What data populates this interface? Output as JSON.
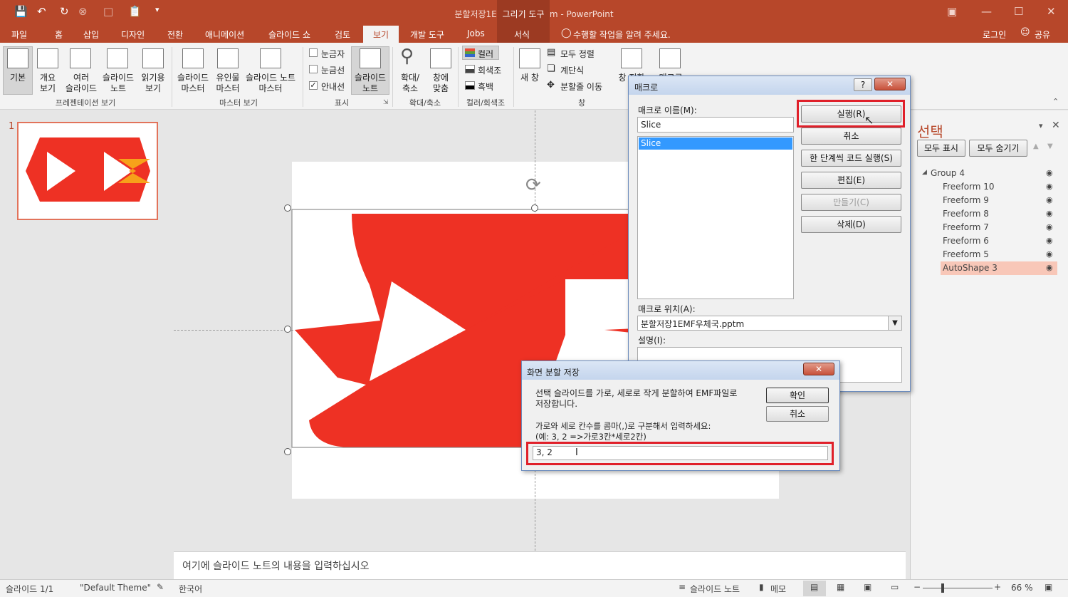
{
  "titlebar": {
    "title": "분할저장1EMF우체국.pptm - PowerPoint",
    "context_tab_header": "그리기 도구"
  },
  "tabs": [
    "파일",
    "홈",
    "삽입",
    "디자인",
    "전환",
    "애니메이션",
    "슬라이드 쇼",
    "검토",
    "보기",
    "개발 도구",
    "Jobs",
    "서식"
  ],
  "tell_me": "수행할 작업을 알려 주세요.",
  "login": "로그인",
  "share": "공유",
  "ribbon": {
    "presentation_views": {
      "items": [
        "기본",
        "개요\n보기",
        "여러\n슬라이드",
        "슬라이드\n노트",
        "읽기용\n보기"
      ],
      "group": "프레젠테이션 보기"
    },
    "master_views": {
      "items": [
        "슬라이드\n마스터",
        "유인물\n마스터",
        "슬라이드 노트\n마스터"
      ],
      "group": "마스터 보기"
    },
    "show": {
      "checks": [
        {
          "label": "눈금자",
          "checked": false
        },
        {
          "label": "눈금선",
          "checked": false
        },
        {
          "label": "안내선",
          "checked": true
        }
      ],
      "notes": "슬라이드\n노트",
      "group": "표시"
    },
    "zoom": {
      "items": [
        "확대/\n축소",
        "창에\n맞춤"
      ],
      "group": "확대/축소"
    },
    "color": {
      "items": [
        "컬러",
        "회색조",
        "흑백"
      ],
      "group": "컬러/회색조"
    },
    "window": {
      "new_window": "새 창",
      "items": [
        "모두 정렬",
        "계단식",
        "분할줄 이동"
      ],
      "switch": "창 전환",
      "group": "창"
    },
    "macro": {
      "label": "매크로"
    }
  },
  "thumbnail": {
    "number": "1"
  },
  "notes_placeholder": "여기에 슬라이드 노트의 내용을 입력하십시오",
  "selection_pane": {
    "title": "선택",
    "show_all": "모두 표시",
    "hide_all": "모두 숨기기",
    "items": [
      "Group 4",
      "Freeform 10",
      "Freeform 9",
      "Freeform 8",
      "Freeform 7",
      "Freeform 6",
      "Freeform 5",
      "AutoShape 3"
    ],
    "selected": "AutoShape 3"
  },
  "macro_dialog": {
    "title": "매크로",
    "help": "?",
    "name_label": "매크로 이름(M):",
    "name_value": "Slice",
    "list": [
      "Slice"
    ],
    "buttons": [
      "실행(R)",
      "취소",
      "한 단계씩 코드 실행(S)",
      "편집(E)",
      "만들기(C)",
      "삭제(D)"
    ],
    "location_label": "매크로 위치(A):",
    "location_value": "분할저장1EMF우체국.pptm",
    "desc_label": "설명(I):"
  },
  "split_dialog": {
    "title": "화면 분할 저장",
    "message": "선택 슬라이드를 가로, 세로로 작게 분할하여 EMF파일로\n저장합니다.",
    "prompt": "가로와 세로 칸수를 콤마(,)로 구분해서 입력하세요:\n(예: 3, 2 =>가로3칸*세로2칸)",
    "input_value": "3, 2",
    "ok": "확인",
    "cancel": "취소"
  },
  "status": {
    "slide": "슬라이드 1/1",
    "theme": "\"Default Theme\"",
    "language": "한국어",
    "notes": "슬라이드 노트",
    "comments": "메모",
    "zoom": "66 %"
  },
  "colors": {
    "accent": "#b7472a",
    "shape_red": "#ee3124",
    "chevron_orange": "#f7a11a",
    "highlight": "#f8c7b8"
  }
}
